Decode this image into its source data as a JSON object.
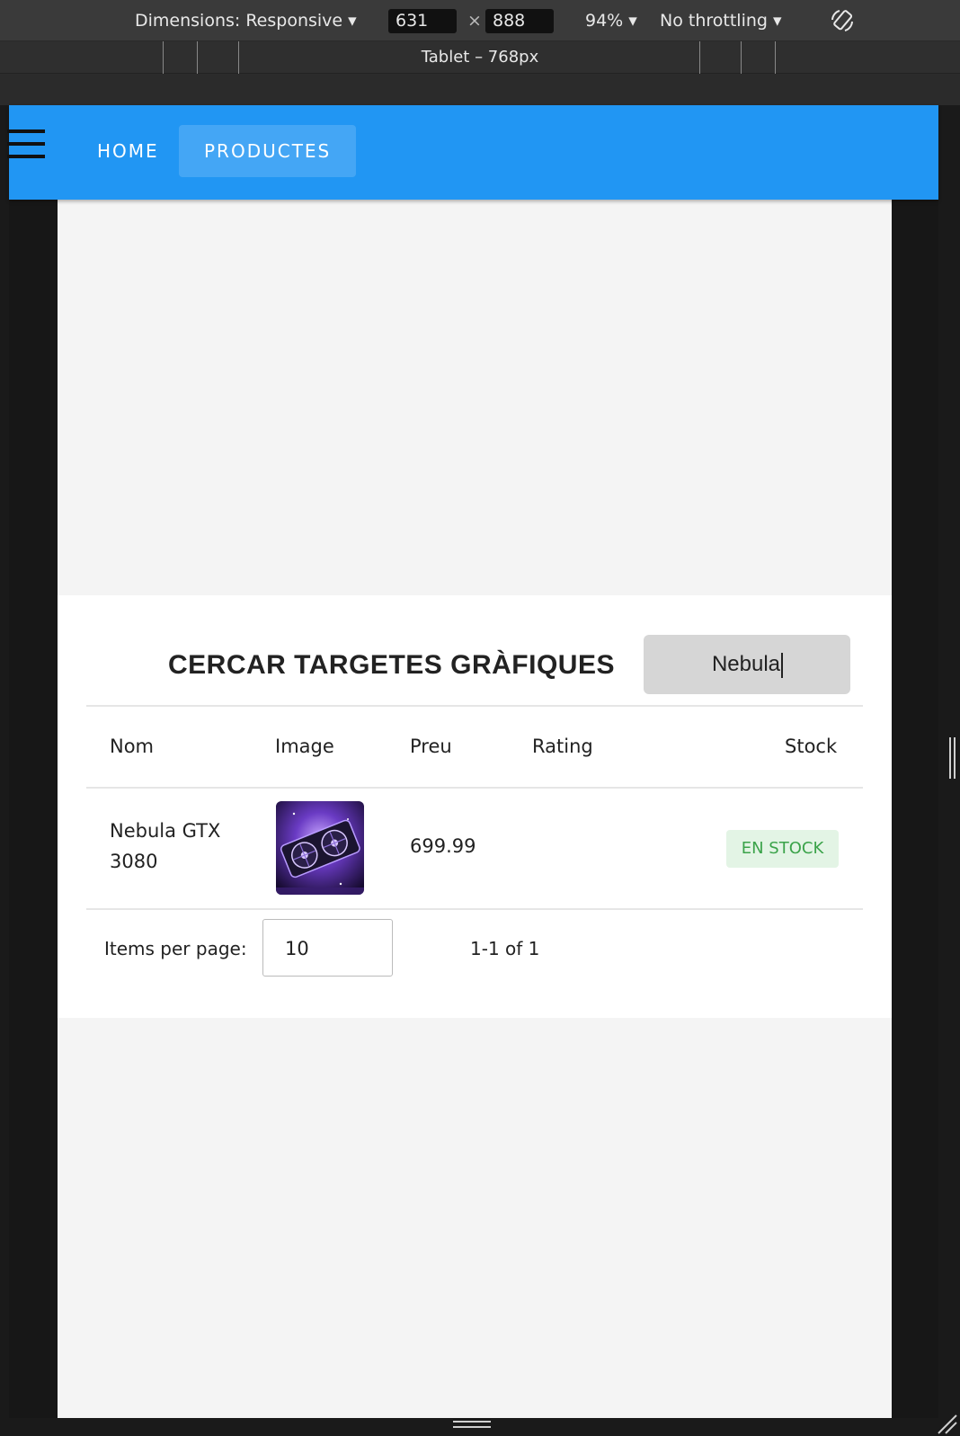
{
  "devtools": {
    "dimensions_label": "Dimensions: Responsive ▾",
    "width_value": "631",
    "times": "×",
    "height_value": "888",
    "zoom": "94% ▾",
    "throttling": "No throttling ▾",
    "device_label": "Tablet – 768px"
  },
  "navbar": {
    "home": "HOME",
    "products": "PRODUCTES"
  },
  "search": {
    "title": "CERCAR TARGETES GRÀFIQUES",
    "value": "Nebula"
  },
  "table": {
    "headers": [
      "Nom",
      "Image",
      "Preu",
      "Rating",
      "Stock"
    ],
    "rows": [
      {
        "name_line1": "Nebula GTX",
        "name_line2": "3080",
        "price": "699.99",
        "rating": "",
        "stock": "EN STOCK"
      }
    ]
  },
  "pagination": {
    "items_label": "Items per page:",
    "items_value": "10",
    "range": "1-1 of 1"
  },
  "colors": {
    "appbar": "#2196f3",
    "stock_chip_bg": "#e3f4e5",
    "stock_chip_text": "#3ba34a"
  }
}
